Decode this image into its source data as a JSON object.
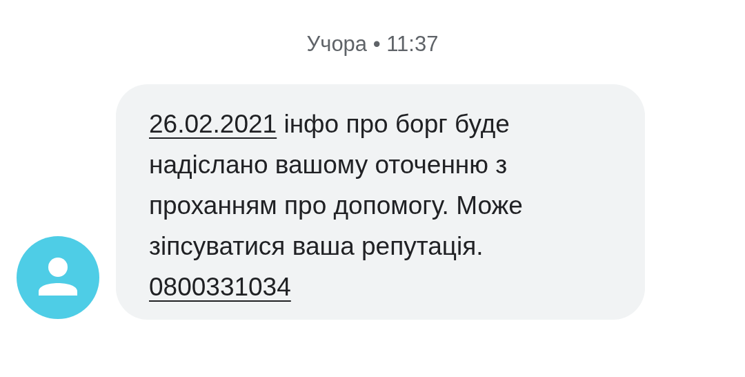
{
  "timestamp": "Учора • 11:37",
  "message": {
    "parts": [
      {
        "kind": "link",
        "text": "26.02.2021"
      },
      {
        "kind": "text",
        "text": " інфо про борг буде надіслано вашому оточенню з проханням про допомогу. Може зіпсуватися ваша репутація. "
      },
      {
        "kind": "link",
        "text": "0800331034"
      }
    ]
  }
}
